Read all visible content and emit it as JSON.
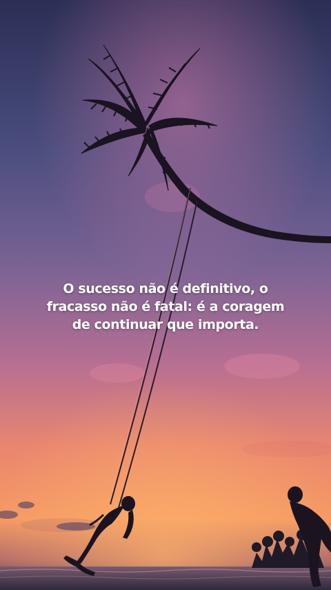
{
  "quote": {
    "text": "O sucesso não é definitivo, o fracasso não é fatal: é a coragem de continuar que importa."
  },
  "scene": {
    "description_icons": [
      "palm-tree-icon",
      "swing-icon",
      "person-on-swing-icon",
      "standing-person-icon"
    ],
    "colors": {
      "sky_top": "#2d3158",
      "sky_mid": "#6b5a8e",
      "sky_pink": "#c76a8e",
      "horizon_orange": "#f08a5a",
      "horizon_glow": "#f6a36a",
      "sea": "#3a3550",
      "silhouette": "#1b1420"
    }
  }
}
